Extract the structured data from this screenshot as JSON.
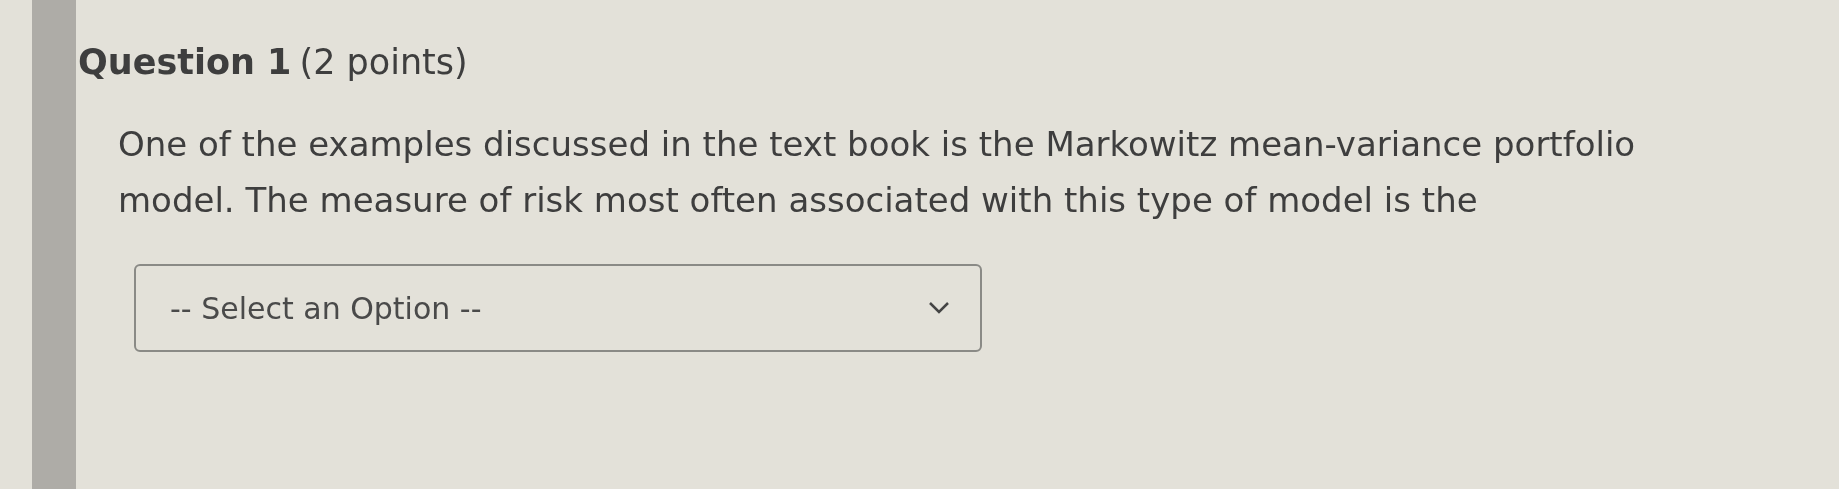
{
  "question": {
    "number": "Question 1",
    "points": "(2 points)",
    "text": "One of the examples discussed in the text book is the Markowitz mean-variance portfolio model. The measure of risk most often associated with this type of model is the"
  },
  "select": {
    "placeholder": "-- Select an Option --"
  }
}
